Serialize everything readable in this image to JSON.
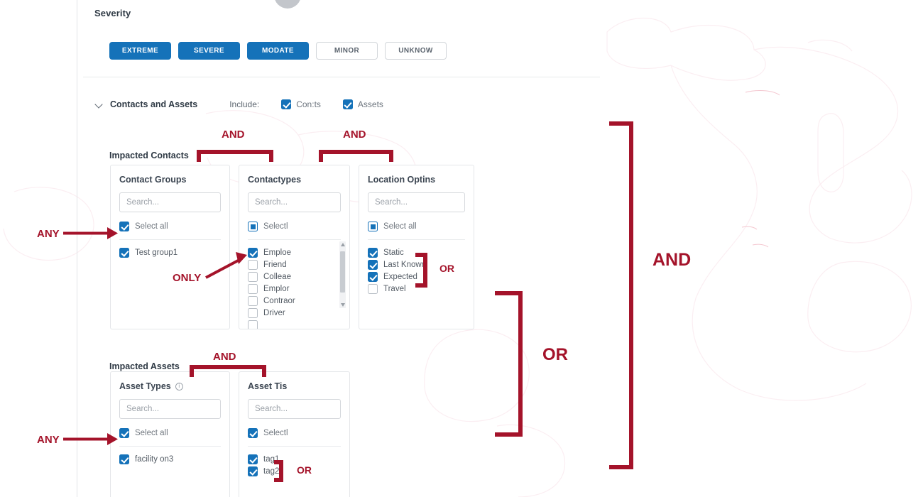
{
  "severity": {
    "label": "Severity",
    "buttons": [
      {
        "label": "EXTREME",
        "state": "on"
      },
      {
        "label": "SEVERE",
        "state": "on"
      },
      {
        "label": "MODATE",
        "state": "on"
      },
      {
        "label": "MINOR",
        "state": "off"
      },
      {
        "label": "UNKNOW",
        "state": "off"
      }
    ]
  },
  "contacts_and_assets": {
    "title": "Contacts and Assets",
    "include_label": "Include:",
    "include_options": [
      {
        "label": "Con:ts",
        "checked": true
      },
      {
        "label": "Assets",
        "checked": true
      }
    ]
  },
  "impacted_contacts": {
    "title": "Impacted Contacts",
    "panels": [
      {
        "title": "Contact Groups",
        "search_placeholder": "Search...",
        "select_all": {
          "label": "Select all",
          "state": "checked"
        },
        "options": [
          {
            "label": "Test group1",
            "state": "checked"
          }
        ]
      },
      {
        "title": "Contactypes",
        "search_placeholder": "Search...",
        "select_all": {
          "label": "Selectl",
          "state": "indeterminate"
        },
        "options": [
          {
            "label": "Emploe",
            "state": "checked"
          },
          {
            "label": "Friend",
            "state": "unchecked"
          },
          {
            "label": "Colleae",
            "state": "unchecked"
          },
          {
            "label": "Emplor",
            "state": "unchecked"
          },
          {
            "label": "Contraor",
            "state": "unchecked"
          },
          {
            "label": "Driver",
            "state": "unchecked"
          }
        ],
        "has_scrollbar": true
      },
      {
        "title": "Location Optins",
        "search_placeholder": "Search...",
        "select_all": {
          "label": "Select all",
          "state": "indeterminate"
        },
        "options": [
          {
            "label": "Static",
            "state": "checked"
          },
          {
            "label": "Last Known",
            "state": "checked"
          },
          {
            "label": "Expected",
            "state": "checked"
          },
          {
            "label": "Travel",
            "state": "unchecked"
          }
        ]
      }
    ]
  },
  "impacted_assets": {
    "title": "Impacted Assets",
    "panels": [
      {
        "title": "Asset Types",
        "has_info_icon": true,
        "info_glyph": "i",
        "search_placeholder": "Search...",
        "select_all": {
          "label": "Select all",
          "state": "checked"
        },
        "options": [
          {
            "label": "facility on3",
            "state": "checked"
          }
        ]
      },
      {
        "title": "Asset Tis",
        "has_info_icon": false,
        "search_placeholder": "Search...",
        "select_all": {
          "label": "Selectl",
          "state": "checked"
        },
        "options": [
          {
            "label": "tag1",
            "state": "checked"
          },
          {
            "label": "tag2",
            "state": "checked"
          }
        ]
      }
    ]
  },
  "annotations": {
    "color": "#a4132a",
    "labels": {
      "and_contact_groups": "AND",
      "and_contact_types": "AND",
      "and_asset_types": "AND",
      "any_contact_groups": "ANY",
      "any_asset_types": "ANY",
      "only_contact_types": "ONLY",
      "or_location": "OR",
      "or_asset_tags": "OR",
      "or_sections": "OR",
      "and_sections": "AND"
    }
  }
}
